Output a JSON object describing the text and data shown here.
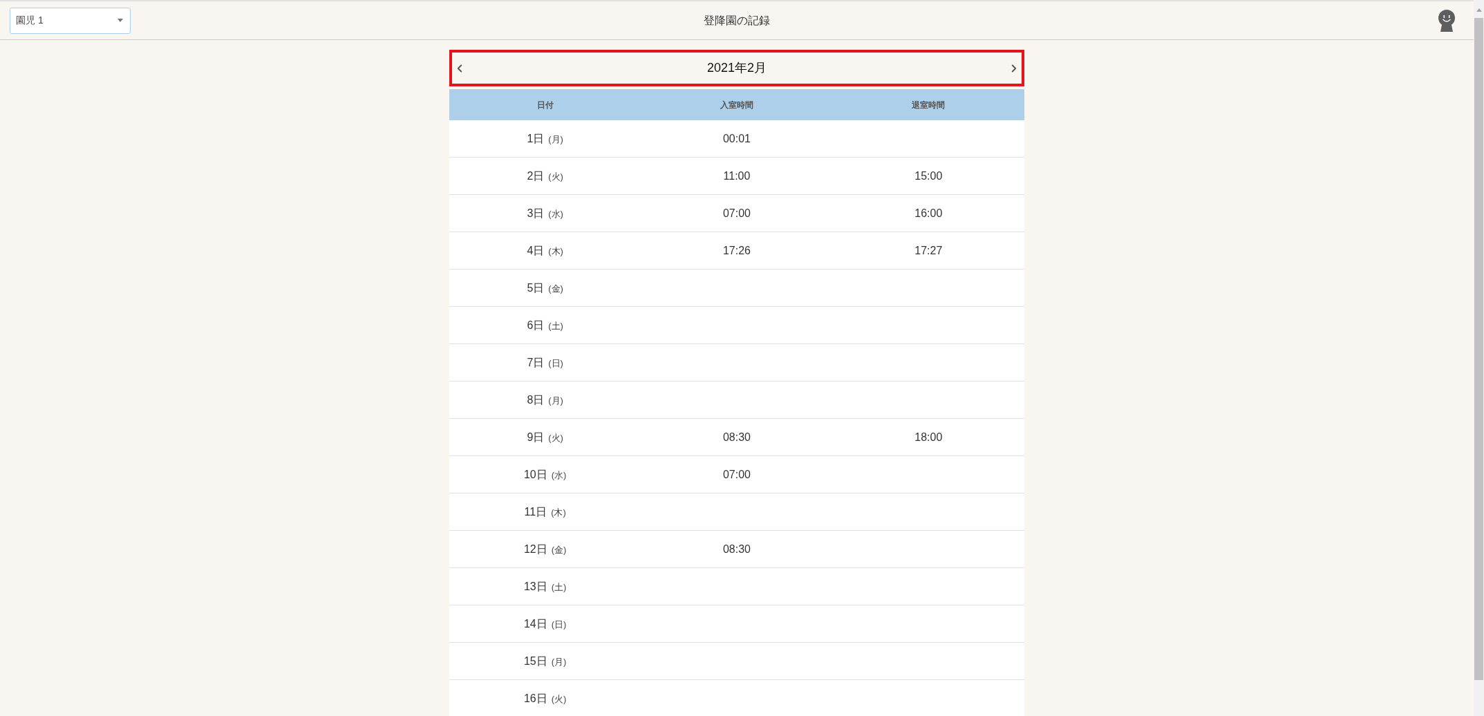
{
  "header": {
    "child_select": {
      "value": "園児 1"
    },
    "title": "登降園の記録"
  },
  "calendar": {
    "month": "2021年2月"
  },
  "table": {
    "columns": [
      "日付",
      "入室時間",
      "退室時間"
    ],
    "rows": [
      {
        "day": "1日",
        "weekday": "(月)",
        "entry": "00:01"
      },
      {
        "day": "2日",
        "weekday": "(火)",
        "entry": "11:00",
        "exit": "15:00"
      },
      {
        "day": "3日",
        "weekday": "(水)",
        "entry": "07:00",
        "exit": "16:00"
      },
      {
        "day": "4日",
        "weekday": "(木)",
        "entry": "17:26",
        "exit": "17:27"
      },
      {
        "day": "5日",
        "weekday": "(金)"
      },
      {
        "day": "6日",
        "weekday": "(土)"
      },
      {
        "day": "7日",
        "weekday": "(日)"
      },
      {
        "day": "8日",
        "weekday": "(月)"
      },
      {
        "day": "9日",
        "weekday": "(火)",
        "entry": "08:30",
        "exit": "18:00"
      },
      {
        "day": "10日",
        "weekday": "(水)",
        "entry": "07:00"
      },
      {
        "day": "11日",
        "weekday": "(木)"
      },
      {
        "day": "12日",
        "weekday": "(金)",
        "entry": "08:30"
      },
      {
        "day": "13日",
        "weekday": "(土)"
      },
      {
        "day": "14日",
        "weekday": "(日)"
      },
      {
        "day": "15日",
        "weekday": "(月)"
      },
      {
        "day": "16日",
        "weekday": "(火)"
      }
    ]
  }
}
